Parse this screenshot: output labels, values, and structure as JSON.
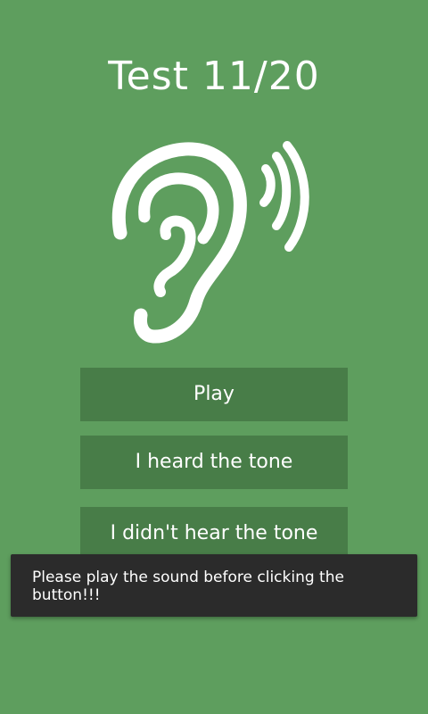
{
  "header": {
    "title": "Test 11/20"
  },
  "illustration": {
    "icon": "ear-sound-icon",
    "color": "#ffffff"
  },
  "buttons": {
    "play": "Play",
    "heard": "I heard the tone",
    "not_heard": "I didn't hear the tone"
  },
  "toast": {
    "message": "Please play the sound before clicking the button!!!"
  },
  "colors": {
    "background": "#5e9e5e",
    "button": "#487d48",
    "toast": "#2b2b2b"
  }
}
